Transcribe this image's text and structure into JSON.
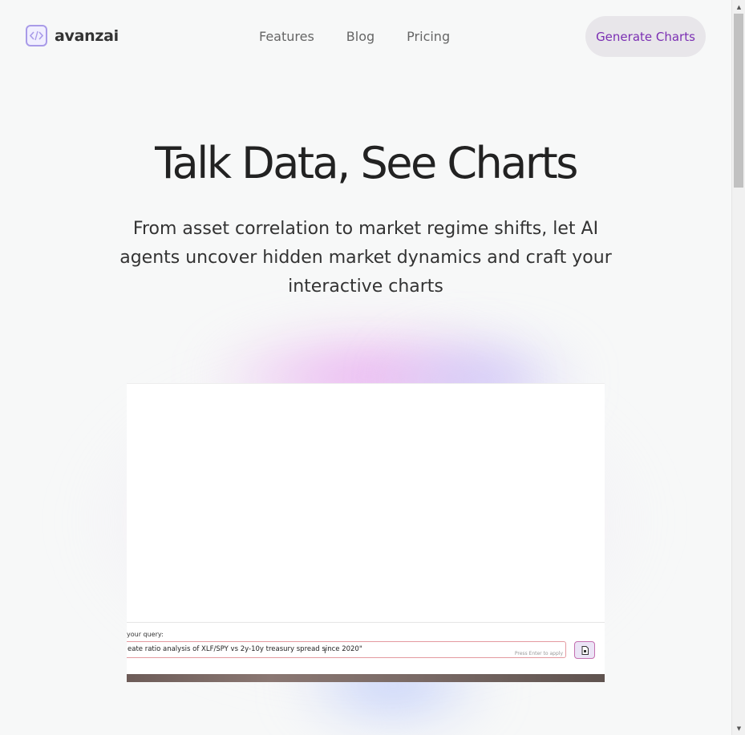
{
  "header": {
    "logo_text": "avanzai",
    "nav": [
      "Features",
      "Blog",
      "Pricing"
    ],
    "cta_label": "Generate Charts"
  },
  "hero": {
    "title": "Talk Data, See Charts",
    "subtitle": "From asset correlation to market regime shifts, let AI agents uncover hidden market dynamics and craft your interactive charts"
  },
  "demo": {
    "query_label": "your query:",
    "query_value": "eate ratio analysis of XLF/SPY vs 2y-10y treasury spread since 2020\"",
    "hint": "Press Enter to apply",
    "submit_icon": "document-icon"
  },
  "colors": {
    "accent": "#7b2fb3",
    "logo_border": "#a99be8",
    "input_border": "#e49aa0"
  }
}
